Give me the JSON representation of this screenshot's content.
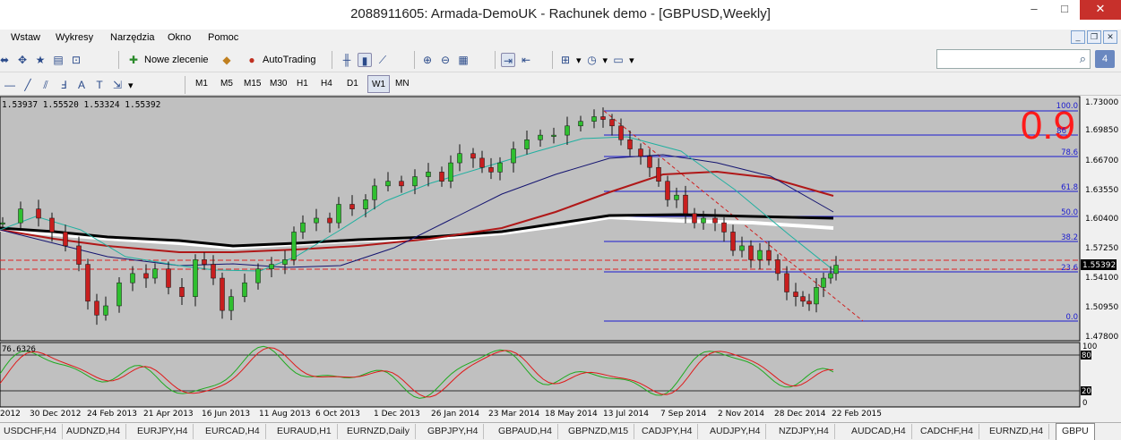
{
  "window": {
    "title": "2088911605: Armada-DemoUK - Rachunek demo - [GBPUSD,Weekly]",
    "min": "–",
    "max": "□",
    "close": "✕"
  },
  "menu": [
    "Wstaw",
    "Wykresy",
    "Narzędzia",
    "Okno",
    "Pomoc"
  ],
  "toolbar": {
    "new_order_label": "Nowe zlecenie",
    "autotrading_label": "AutoTrading"
  },
  "timeframes": [
    "M1",
    "M5",
    "M15",
    "M30",
    "H1",
    "H4",
    "D1",
    "W1",
    "MN"
  ],
  "active_timeframe": "W1",
  "search": {
    "placeholder": ""
  },
  "chart": {
    "ohlc_header": "1.53937 1.55520 1.53324 1.55392",
    "current_price": "1.55392",
    "overlay_number": "0.9",
    "price_ticks": [
      "1.73000",
      "1.69850",
      "1.66700",
      "1.63550",
      "1.60400",
      "1.57250",
      "1.54100",
      "1.50950",
      "1.47800"
    ],
    "date_ticks": [
      "2012",
      "30 Dec 2012",
      "24 Feb 2013",
      "21 Apr 2013",
      "16 Jun 2013",
      "11 Aug 2013",
      "6 Oct 2013",
      "1 Dec 2013",
      "26 Jan 2014",
      "23 Mar 2014",
      "18 May 2014",
      "13 Jul 2014",
      "7 Sep 2014",
      "2 Nov 2014",
      "28 Dec 2014",
      "22 Feb 2015"
    ],
    "fib_levels": [
      "100.0",
      "78.6",
      "61.8",
      "50.0",
      "38.2",
      "23.6",
      "0.0"
    ],
    "fib_partial_label": "86",
    "colors": {
      "bull": "#2fbf2f",
      "bear": "#c81e1e",
      "fib": "#1a1ad0",
      "bg": "#c0c0c0"
    }
  },
  "stoch": {
    "value_label": "76.6326",
    "ticks": [
      "100",
      "80",
      "20",
      "0"
    ]
  },
  "tabs": [
    "USDCHF,H4",
    "AUDNZD,H4",
    "EURJPY,H4",
    "EURCAD,H4",
    "EURAUD,H1",
    "EURNZD,Daily",
    "GBPJPY,H4",
    "GBPAUD,H4",
    "GBPNZD,M15",
    "CADJPY,H4",
    "AUDJPY,H4",
    "NZDJPY,H4",
    "AUDCAD,H4",
    "CADCHF,H4",
    "EURNZD,H4",
    "GBPU"
  ]
}
